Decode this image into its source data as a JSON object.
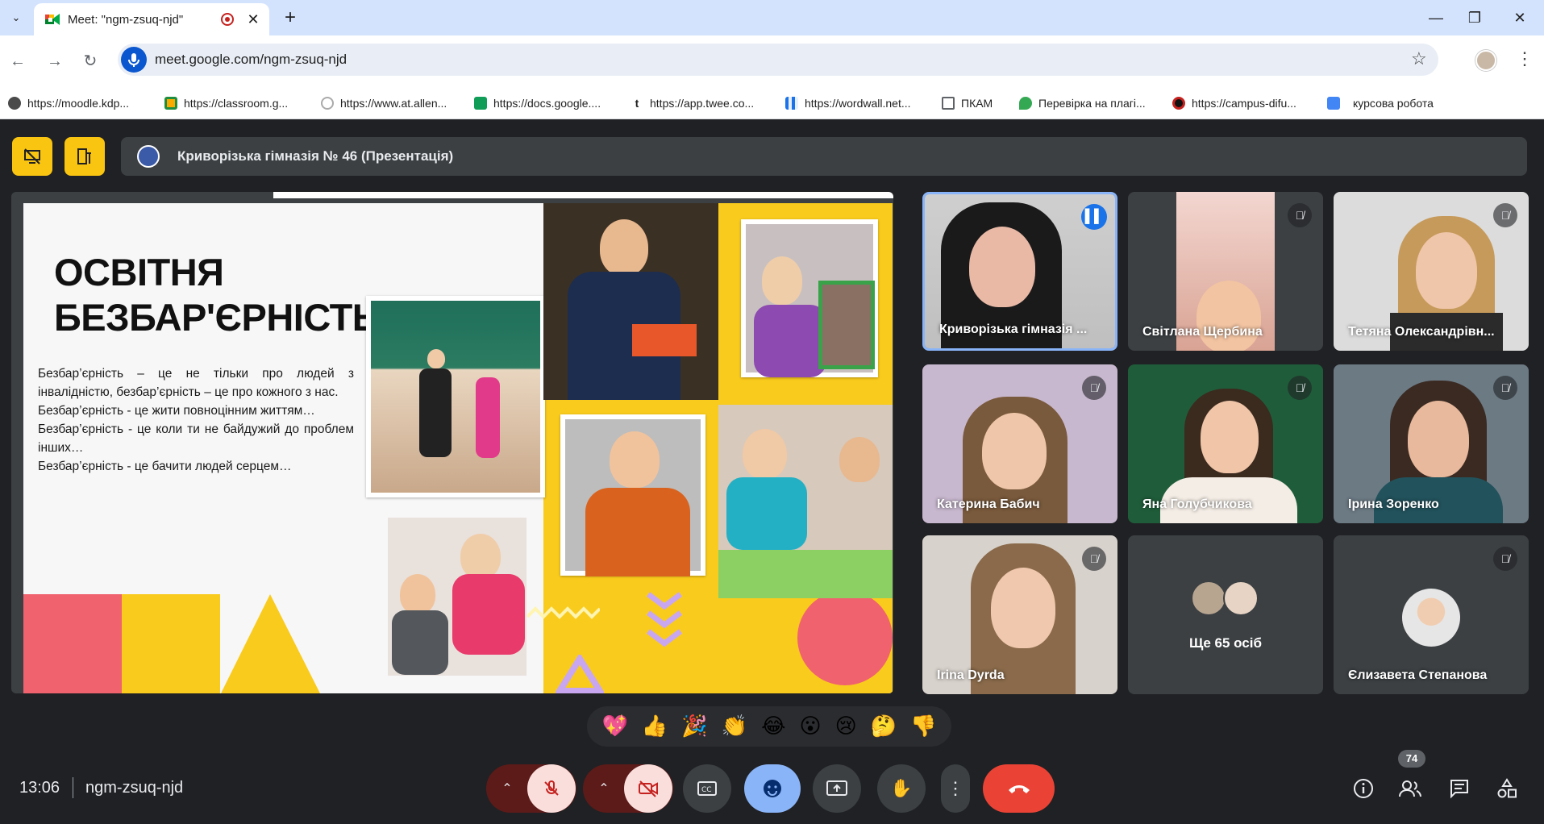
{
  "browser": {
    "tab_title": "Meet: \"ngm-zsuq-njd\"",
    "url": "meet.google.com/ngm-zsuq-njd",
    "bookmarks": [
      {
        "label": "https://moodle.kdp...",
        "color": "#4a4a4a"
      },
      {
        "label": "https://classroom.g...",
        "color": "#1e8e3e"
      },
      {
        "label": "https://www.at.allen...",
        "color": "#e0e0e0"
      },
      {
        "label": "https://docs.google....",
        "color": "#0f9d58"
      },
      {
        "label": "https://app.twee.co...",
        "color": "#222222"
      },
      {
        "label": "https://wordwall.net...",
        "color": "#1a73e8"
      },
      {
        "label": "ПКАМ",
        "color": "#5f6368"
      },
      {
        "label": "Перевірка на плагі...",
        "color": "#34a853"
      },
      {
        "label": "https://campus-difu...",
        "color": "#c5221f"
      },
      {
        "label": "курсова робота",
        "color": "#4285f4"
      }
    ]
  },
  "meet": {
    "presentation_title": "Криворізька гімназія № 46 (Презентація)",
    "slide": {
      "heading_1": "ОСВІТНЯ",
      "heading_2": "БЕЗБАР'ЄРНІСТЬ",
      "lines": [
        "Безбар’єрність – це не тільки про людей з інвалідністю, безбар’єрність – це про кожного з нас.",
        "Безбар’єрність - це жити повноцінним життям…",
        "Безбар’єрність - це коли ти не байдужий до проблем інших…",
        "Безбар’єрність - це бачити людей серцем…"
      ]
    },
    "participants": [
      {
        "name": "Криворізька гімназія ...",
        "speaking": true,
        "muted": false
      },
      {
        "name": "Світлана Щербина",
        "speaking": false,
        "muted": true
      },
      {
        "name": "Тетяна Олександрівн...",
        "speaking": false,
        "muted": true
      },
      {
        "name": "Катерина Бабич",
        "speaking": false,
        "muted": true
      },
      {
        "name": "Яна Голубчикова",
        "speaking": false,
        "muted": true
      },
      {
        "name": "Ірина Зоренко",
        "speaking": false,
        "muted": true
      },
      {
        "name": "Irina Dyrda",
        "speaking": false,
        "muted": true
      },
      {
        "name": "Ще 65 осіб",
        "speaking": false,
        "muted": false
      },
      {
        "name": "Єлизавета Степанова",
        "speaking": false,
        "muted": true
      }
    ],
    "reactions": [
      "💖",
      "👍",
      "🎉",
      "👏",
      "😂",
      "😮",
      "😢",
      "🤔",
      "👎"
    ],
    "time": "13:06",
    "meeting_code": "ngm-zsuq-njd",
    "people_count": "74",
    "colors": {
      "accent": "#8ab4f8",
      "danger": "#ea4335",
      "bg": "#202124",
      "tile": "#3c4043",
      "highlight": "#f9c511"
    }
  }
}
